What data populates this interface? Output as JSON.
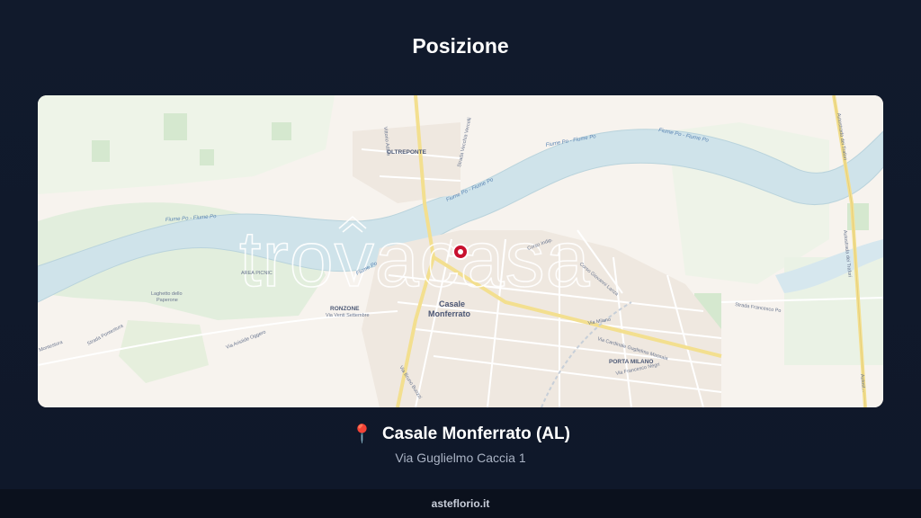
{
  "heading": "Posizione",
  "map": {
    "labels": {
      "oltreponte": "OLTREPONTE",
      "casale_1": "Casale",
      "casale_2": "Monferrato",
      "ronzone": "RONZONE",
      "via_venti_settembre": "Via Venti Settembre",
      "porta_milano": "PORTA MILANO",
      "area_picnic": "AREA PICNIC",
      "laghetto_1": "Laghetto dello",
      "laghetto_2": "Paperone",
      "fiume_po_1": "Fiume Po - Fiume Po",
      "fiume_po_2": "Fiume Po - Fiume Po",
      "fiume_po_3": "Fiume Po - Fiume Po",
      "fiume_po_4": "Fiume Po",
      "fiume_po_5": "Fiume Po - Fiume Po",
      "strada_vecchia": "Strada Vecchia Vercelli",
      "vittorio_adam": "Vittorio Adam",
      "strada_pontestura": "Strada Pontestura",
      "via_aristide": "Via Aristide Oggero",
      "via_bruno_buozzi": "Via Bruno Buozzi",
      "corso_indipendenza": "Corso Indip.",
      "corso_manacorda": "Corso Giovanni Lanza",
      "via_milano": "Via Milano",
      "via_cardinale": "Via Cardinale Guglielmo Massaia",
      "via_francesco_negri": "Via Francesco Negri",
      "strada_francesco": "Strada Francesco Po",
      "autostrada_1": "Autostrada dei Trafori",
      "autostrada_2": "Autostrada dei Trafori",
      "autostrada_3": "Autost...",
      "montestura": "Montestura"
    },
    "watermark": "trovacasa",
    "colors": {
      "land": "#f7f3ee",
      "river": "#cfe3ea",
      "park": "#dfeedd",
      "road_major": "#f6e6a8",
      "marker": "#c8102e"
    }
  },
  "location": {
    "pin_icon": "📍",
    "name": "Casale Monferrato (AL)",
    "address": "Via Guglielmo Caccia 1"
  },
  "footer": {
    "site": "asteflorio.it"
  }
}
